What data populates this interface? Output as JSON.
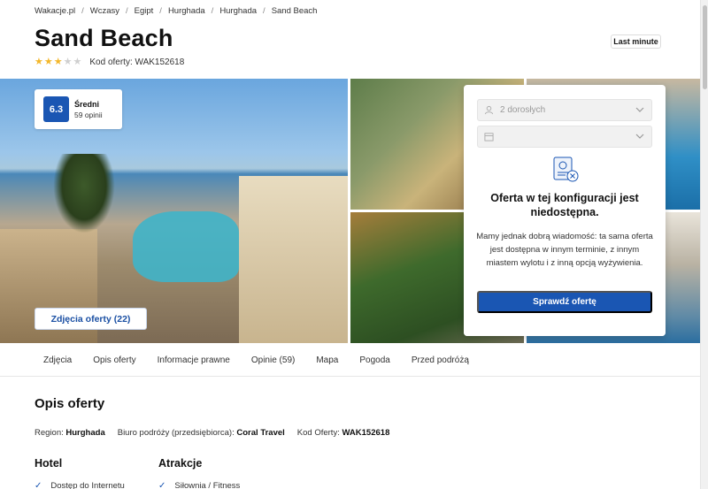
{
  "breadcrumb": [
    "Wakacje.pl",
    "Wczasy",
    "Egipt",
    "Hurghada",
    "Hurghada",
    "Sand Beach"
  ],
  "hotel": {
    "name": "Sand Beach",
    "stars": 3,
    "max_stars": 5,
    "offer_code_label": "Kod oferty: WAK152618",
    "badge": "Last minute"
  },
  "score": {
    "value": "6.3",
    "label": "Średni",
    "count": "59 opinii"
  },
  "gallery": {
    "photos_button": "Zdjęcia oferty (22)"
  },
  "booking": {
    "guests_value": "2 dorosłych",
    "date_value": "",
    "unavailable_title": "Oferta w tej konfiguracji jest niedostępna.",
    "unavailable_text": "Mamy jednak dobrą wiadomość: ta sama oferta jest dostępna w innym terminie, z innym miastem wylotu i z inną opcją wyżywienia.",
    "check_button": "Sprawdź ofertę"
  },
  "tabs": [
    "Zdjęcia",
    "Opis oferty",
    "Informacje prawne",
    "Opinie (59)",
    "Mapa",
    "Pogoda",
    "Przed podróżą"
  ],
  "description": {
    "title": "Opis oferty",
    "region_label": "Region:",
    "region_value": "Hurghada",
    "operator_label": "Biuro podróży (przedsiębiorca):",
    "operator_value": "Coral Travel",
    "code_label": "Kod Oferty:",
    "code_value": "WAK152618"
  },
  "columns": [
    {
      "title": "Hotel",
      "items": [
        "Dostęp do Internetu"
      ]
    },
    {
      "title": "Atrakcje",
      "items": [
        "Siłownia / Fitness"
      ]
    }
  ],
  "colors": {
    "accent": "#1a56b3",
    "star": "#f3b72b"
  }
}
